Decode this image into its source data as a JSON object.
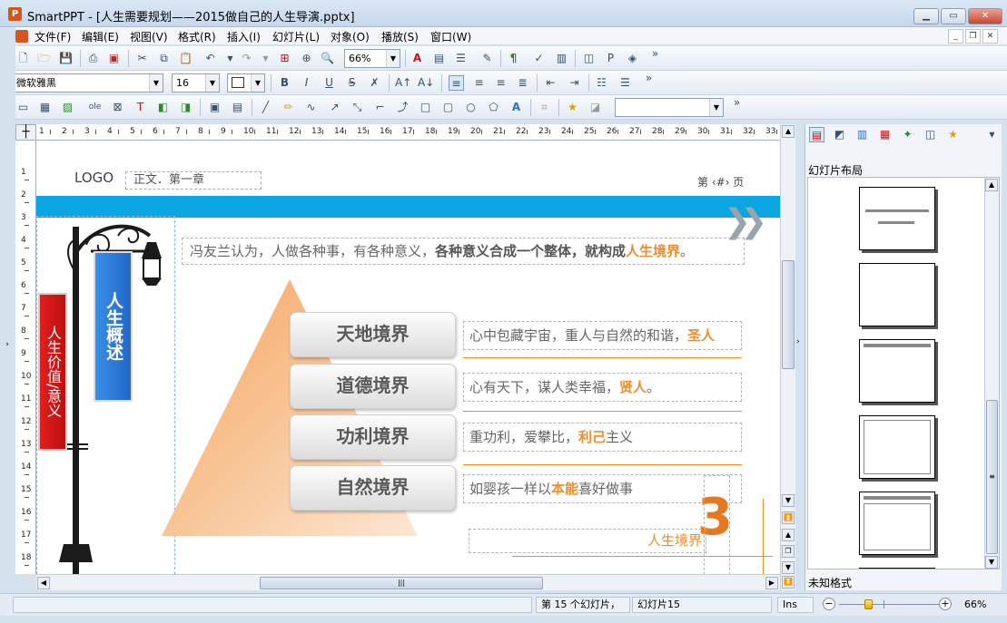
{
  "window": {
    "title": "SmartPPT - [人生需要规划——2015做自己的人生导演.pptx]",
    "app_icon": "P"
  },
  "menu": [
    "文件(F)",
    "编辑(E)",
    "视图(V)",
    "格式(R)",
    "插入(I)",
    "幻灯片(L)",
    "对象(O)",
    "播放(S)",
    "窗口(W)"
  ],
  "toolbar": {
    "zoom": "66%",
    "font_name": "微软雅黑",
    "font_size": "16",
    "overflow": "»"
  },
  "ruler": {
    "h_ticks": [
      "1",
      "2",
      "3",
      "4",
      "5",
      "6",
      "7",
      "8",
      "9",
      "10",
      "11",
      "12",
      "13",
      "14",
      "15",
      "16",
      "17",
      "18",
      "19",
      "20",
      "21",
      "22",
      "23",
      "24",
      "25",
      "26",
      "27",
      "28",
      "29",
      "30",
      "31",
      "32",
      "33"
    ],
    "v_ticks": [
      "1",
      "2",
      "3",
      "4",
      "5",
      "6",
      "7",
      "8",
      "9",
      "10",
      "11",
      "12",
      "13",
      "14",
      "15",
      "16",
      "17",
      "18"
    ]
  },
  "slide": {
    "logo": "LOGO",
    "header": "正文．第一章",
    "page": "第 ‹#› 页",
    "quote_plain": "冯友兰认为，人做各种事，有各种意义，",
    "quote_bold": "各种意义合成一个整体，就构成",
    "quote_hl": "人生境界",
    "quote_end": "。",
    "banner_blue": "人生概述",
    "banner_red": "人生价值/意义",
    "tiers": [
      {
        "label": "天地境界",
        "desc": "心中包藏宇宙，重人与自然的和谐，",
        "hl": "圣人",
        "tail": ""
      },
      {
        "label": "道德境界",
        "desc": "心有天下，谋人类幸福，",
        "hl": "贤人",
        "tail": "。"
      },
      {
        "label": "功利境界",
        "desc": "重功利，爱攀比，",
        "hl": "利己",
        "tail": "主义"
      },
      {
        "label": "自然境界",
        "desc": "如婴孩一样以",
        "hl": "本能",
        "tail": "喜好做事"
      }
    ],
    "footer_title": "人生境界",
    "big_number": "3"
  },
  "right_panel": {
    "title": "幻灯片布局",
    "footer": "未知格式"
  },
  "status": {
    "slide_count": "第 15 个幻灯片，",
    "slide_name": "幻灯片15",
    "mode": "Ins",
    "zoom": "66%"
  }
}
